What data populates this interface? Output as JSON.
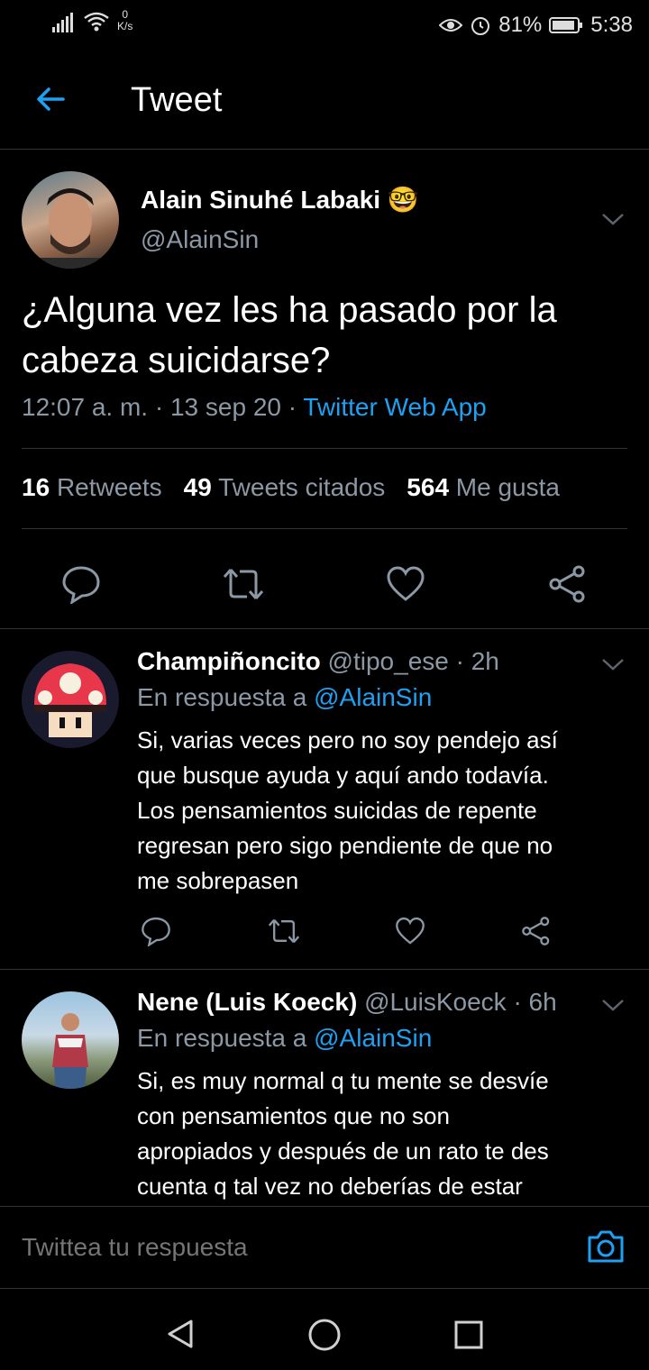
{
  "status_bar": {
    "speed_value": "0",
    "speed_unit": "K/s",
    "battery": "81%",
    "time": "5:38"
  },
  "header": {
    "title": "Tweet"
  },
  "tweet": {
    "author_name": "Alain Sinuhé Labaki 🤓",
    "handle": "@AlainSin",
    "text_line1": "¿Alguna vez les ha pasado por la",
    "text_line2": "cabeza suicidarse?",
    "time": "12:07 a. m.",
    "date": "13 sep 20",
    "source": "Twitter Web App",
    "separator": "·",
    "stats": [
      {
        "count": "16",
        "label": "Retweets"
      },
      {
        "count": "49",
        "label": "Tweets citados"
      },
      {
        "count": "564",
        "label": "Me gusta"
      }
    ]
  },
  "replies": [
    {
      "name": "Champiñoncito",
      "handle": "@tipo_ese",
      "time": "· 2h",
      "in_reply_prefix": "En respuesta a",
      "in_reply_handle": "@AlainSin",
      "lines": [
        "Si, varias veces pero no soy pendejo así",
        "que busque ayuda y aquí ando todavía.",
        "Los pensamientos suicidas de repente",
        "regresan pero sigo pendiente de que no",
        "me sobrepasen"
      ]
    },
    {
      "name": "Nene (Luis Koeck)",
      "handle": "@LuisKoeck",
      "time": "· 6h",
      "in_reply_prefix": "En respuesta a",
      "in_reply_handle": "@AlainSin",
      "lines": [
        "Si, es muy normal q tu mente se desvíe",
        "con pensamientos que no son",
        "apropiados y después de un rato te des",
        "cuenta q tal vez no deberías de estar"
      ]
    }
  ],
  "composer": {
    "placeholder": "Twittea tu respuesta"
  },
  "colors": {
    "accent": "#1da1f2",
    "muted": "#8b98a5",
    "divider": "#2f3336",
    "background": "#000000"
  }
}
